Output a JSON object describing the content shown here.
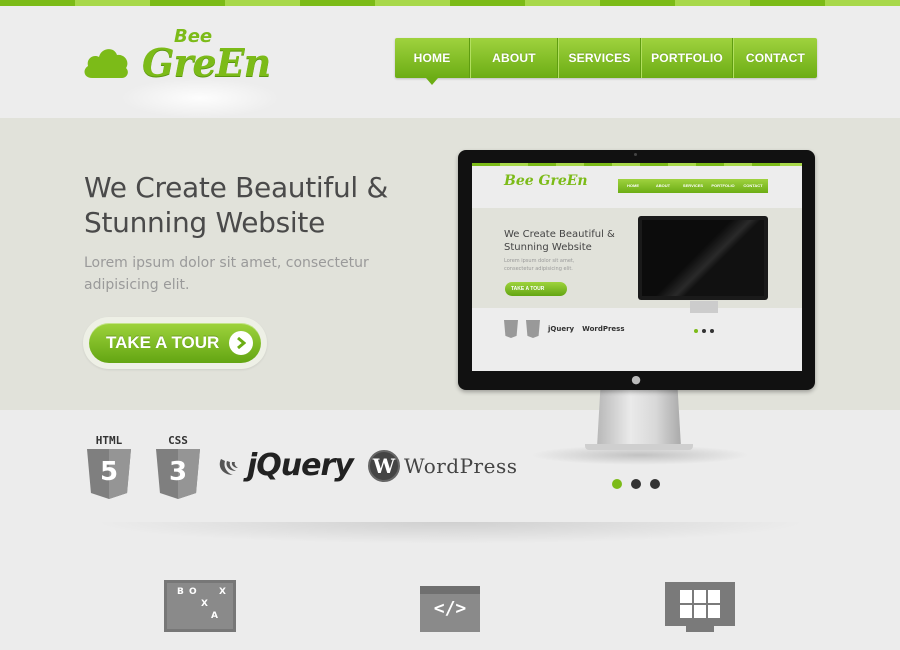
{
  "header": {
    "logo_small": "Bee",
    "logo_big": "GreEn"
  },
  "nav": {
    "items": [
      {
        "label": "HOME",
        "active": true
      },
      {
        "label": "ABOUT"
      },
      {
        "label": "SERVICES"
      },
      {
        "label": "PORTFOLIO"
      },
      {
        "label": "CONTACT"
      }
    ]
  },
  "hero": {
    "title": "We Create Beautiful & Stunning Website",
    "subtitle": "Lorem ipsum dolor sit amet, consectetur adipisicing elit.",
    "cta_label": "TAKE A TOUR"
  },
  "preview": {
    "logo": "Bee GreEn",
    "nav": [
      "HOME",
      "ABOUT",
      "SERVICES",
      "PORTFOLIO",
      "CONTACT"
    ],
    "title": "We Create Beautiful & Stunning Website",
    "subtitle": "Lorem ipsum dolor sit amet, consectetur adipisicing elit.",
    "cta_label": "TAKE A TOUR",
    "logos": [
      "jQuery",
      "WordPress"
    ]
  },
  "tech": {
    "html_label": "HTML",
    "html_num": "5",
    "css_label": "CSS",
    "css_num": "3",
    "jquery": "jQuery",
    "wordpress": "WordPress",
    "wordpress_glyph": "W"
  },
  "slider": {
    "count": 3,
    "active_index": 0
  },
  "features": {
    "board_letters": [
      "B",
      "O",
      "X",
      "X",
      "A"
    ],
    "code_symbol": "</>"
  },
  "colors": {
    "accent": "#7cbb18",
    "accent_light": "#a8d84a",
    "hero_bg": "#e1e2da"
  }
}
